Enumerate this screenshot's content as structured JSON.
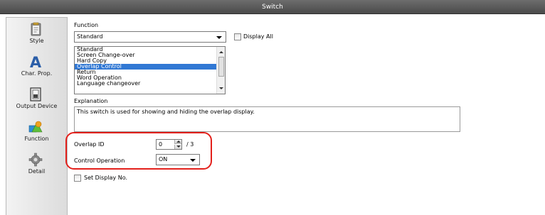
{
  "window": {
    "title": "Switch"
  },
  "sidebar": {
    "items": [
      {
        "label": "Style",
        "icon": "clipboard-style-icon"
      },
      {
        "label": "Char. Prop.",
        "icon": "char-a-icon"
      },
      {
        "label": "Output Device",
        "icon": "output-device-icon"
      },
      {
        "label": "Function",
        "icon": "function-shapes-icon"
      },
      {
        "label": "Detail",
        "icon": "gear-detail-icon"
      }
    ]
  },
  "function": {
    "label": "Function",
    "selected": "Standard",
    "display_all_label": "Display All",
    "list_items": [
      "Standard",
      "Screen Change-over",
      "Hard Copy",
      "Overlap Control",
      "Return",
      "Word Operation",
      "Language changeover"
    ],
    "list_selected_index": 3
  },
  "explanation": {
    "label": "Explanation",
    "text": "This switch is used for showing and hiding the overlap display."
  },
  "overlap": {
    "id_label": "Overlap ID",
    "id_value": "0",
    "id_max": "/ 3",
    "control_label": "Control Operation",
    "control_value": "ON"
  },
  "set_display": {
    "label": "Set Display No."
  },
  "colors": {
    "highlight": "#e3201b",
    "selection": "#3178d4",
    "titlebar": "#5a5a5a"
  }
}
